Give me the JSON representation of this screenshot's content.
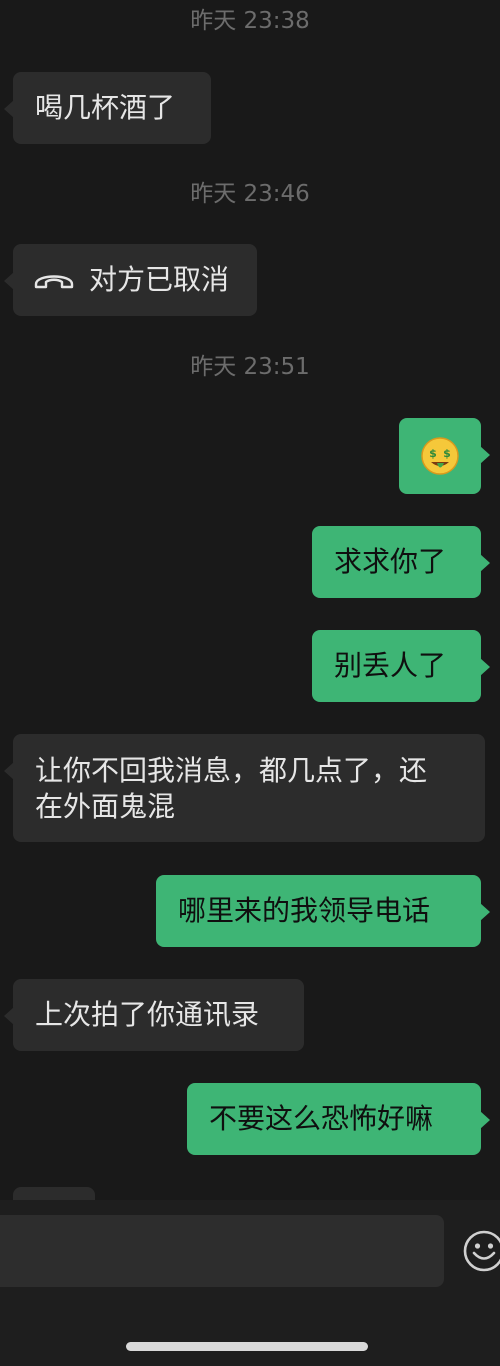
{
  "messages": [
    {
      "type": "time",
      "text": "昨天 23:38"
    },
    {
      "type": "in",
      "text": "喝几杯酒了"
    },
    {
      "type": "time",
      "text": "昨天 23:46"
    },
    {
      "type": "in-call",
      "icon": "phone-hangup-icon",
      "text": "对方已取消"
    },
    {
      "type": "time",
      "text": "昨天 23:51"
    },
    {
      "type": "out-emoji",
      "icon": "money-face-emoji"
    },
    {
      "type": "out",
      "text": "求求你了"
    },
    {
      "type": "out",
      "text": "别丢人了"
    },
    {
      "type": "in",
      "line1": "让你不回我消息，都几点了，还",
      "line2": "在外面鬼混"
    },
    {
      "type": "out",
      "text": "哪里来的我领导电话"
    },
    {
      "type": "in",
      "text": "上次拍了你通讯录"
    },
    {
      "type": "out",
      "text": "不要这么恐怖好嘛"
    }
  ],
  "input_bar": {
    "input_value": "",
    "emoji_button_icon": "smiley-face-icon"
  },
  "colors": {
    "background": "#191919",
    "incoming_bubble": "#2c2c2c",
    "outgoing_bubble": "#3eb575",
    "timestamp": "#6c6c6c"
  }
}
